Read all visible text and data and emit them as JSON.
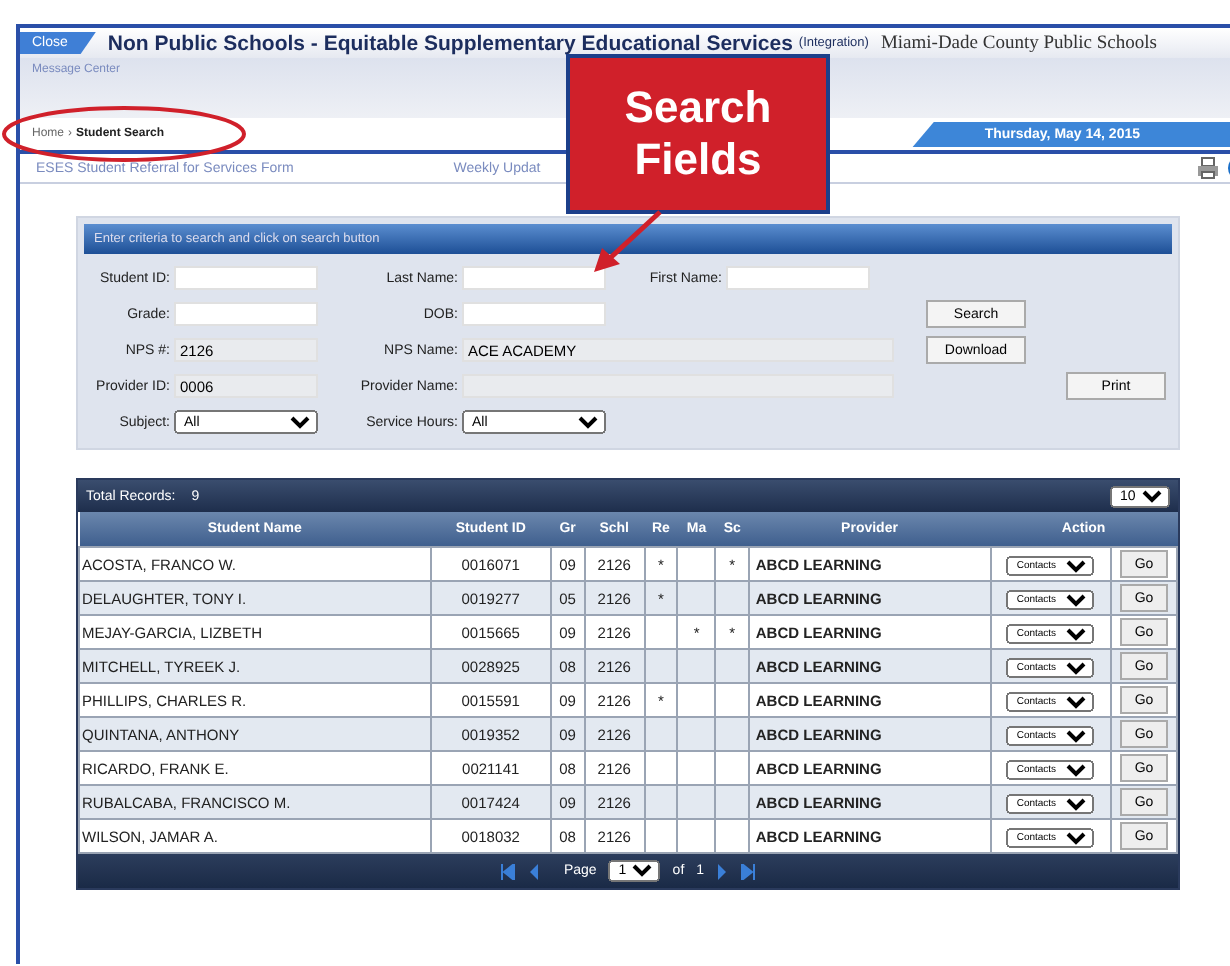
{
  "header": {
    "close": "Close",
    "title": "Non Public Schools - Equitable Supplementary Educational Services",
    "subtitle": "(Integration)",
    "district": "Miami-Dade County Public Schools",
    "message_center": "Message Center"
  },
  "breadcrumb": {
    "home": "Home",
    "separator": "›",
    "current": "Student Search",
    "date": "Thursday, May 14, 2015"
  },
  "tabs": [
    {
      "label": "ESES Student Referral for Services Form",
      "selected": false
    },
    {
      "label": "Weekly Updat",
      "selected": false
    }
  ],
  "callout": {
    "line1": "Search",
    "line2": "Fields"
  },
  "search": {
    "title": "Enter criteria to search and click on search button",
    "rows": [
      {
        "fields": [
          {
            "label": "Student ID:",
            "kind": "text"
          },
          {
            "label": "Last Name:",
            "kind": "text"
          },
          {
            "label": "First Name:",
            "kind": "text"
          }
        ]
      },
      {
        "fields": [
          {
            "label": "Grade:",
            "kind": "text"
          },
          {
            "label": "DOB:",
            "kind": "text"
          }
        ],
        "button": "Search"
      },
      {
        "fields": [
          {
            "label": "NPS #:",
            "kind": "text",
            "value": "2126",
            "readonly": true
          },
          {
            "label": "NPS Name:",
            "kind": "text",
            "value": "ACE ACADEMY",
            "readonly": true,
            "wide": true
          }
        ],
        "button": "Download"
      },
      {
        "fields": [
          {
            "label": "Provider ID:",
            "kind": "text",
            "value": "0006",
            "readonly": true
          },
          {
            "label": "Provider Name:",
            "kind": "text",
            "readonly": true,
            "wide": true
          }
        ],
        "side_button": "Print"
      },
      {
        "fields": [
          {
            "label": "Subject:",
            "kind": "select",
            "value": "All"
          },
          {
            "label": "Service Hours:",
            "kind": "select",
            "value": "All"
          }
        ]
      }
    ]
  },
  "results": {
    "total_label": "Total Records:",
    "total": "9",
    "page_size": "10",
    "columns": [
      "Student Name",
      "Student ID",
      "Gr",
      "Schl",
      "Re",
      "Ma",
      "Sc",
      "Provider",
      "Action"
    ],
    "rows": [
      {
        "name": "ACOSTA, FRANCO W.",
        "id": "0016071",
        "gr": "09",
        "schl": "2126",
        "re": "*",
        "sc": "*",
        "provider": "ABCD LEARNING",
        "action": "Contacts",
        "go": "Go"
      },
      {
        "name": "DELAUGHTER, TONY I.",
        "id": "0019277",
        "gr": "05",
        "schl": "2126",
        "re": "*",
        "provider": "ABCD LEARNING",
        "action": "Contacts",
        "go": "Go"
      },
      {
        "name": "MEJAY-GARCIA, LIZBETH",
        "id": "0015665",
        "gr": "09",
        "schl": "2126",
        "ma": "*",
        "sc": "*",
        "provider": "ABCD LEARNING",
        "action": "Contacts",
        "go": "Go"
      },
      {
        "name": "MITCHELL, TYREEK J.",
        "id": "0028925",
        "gr": "08",
        "schl": "2126",
        "provider": "ABCD LEARNING",
        "action": "Contacts",
        "go": "Go"
      },
      {
        "name": "PHILLIPS, CHARLES R.",
        "id": "0015591",
        "gr": "09",
        "schl": "2126",
        "re": "*",
        "provider": "ABCD LEARNING",
        "action": "Contacts",
        "go": "Go"
      },
      {
        "name": "QUINTANA, ANTHONY",
        "id": "0019352",
        "gr": "09",
        "schl": "2126",
        "provider": "ABCD LEARNING",
        "action": "Contacts",
        "go": "Go"
      },
      {
        "name": "RICARDO, FRANK E.",
        "id": "0021141",
        "gr": "08",
        "schl": "2126",
        "provider": "ABCD LEARNING",
        "action": "Contacts",
        "go": "Go"
      },
      {
        "name": "RUBALCABA, FRANCISCO M.",
        "id": "0017424",
        "gr": "09",
        "schl": "2126",
        "provider": "ABCD LEARNING",
        "action": "Contacts",
        "go": "Go"
      },
      {
        "name": "WILSON, JAMAR A.",
        "id": "0018032",
        "gr": "08",
        "schl": "2126",
        "provider": "ABCD LEARNING",
        "action": "Contacts",
        "go": "Go"
      }
    ],
    "pager": {
      "page_label": "Page",
      "page": "1",
      "of_label": "of",
      "pages": "1"
    }
  }
}
